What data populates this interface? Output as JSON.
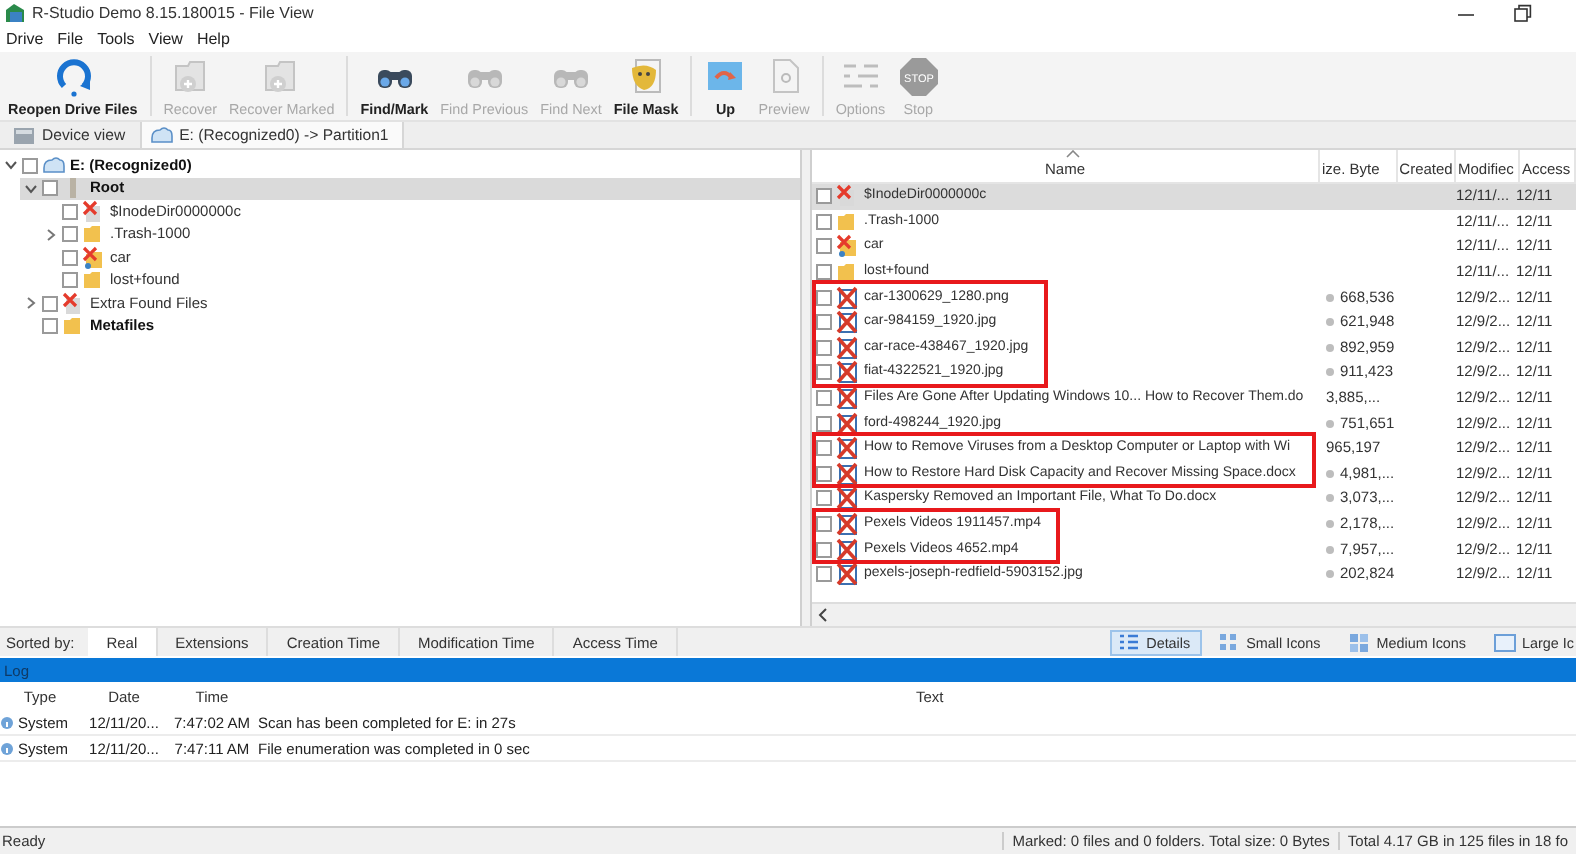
{
  "window": {
    "title": "R-Studio Demo 8.15.180015 - File View"
  },
  "menu": [
    "Drive",
    "File",
    "Tools",
    "View",
    "Help"
  ],
  "toolbar": [
    {
      "buttons": [
        {
          "label": "Reopen Drive Files",
          "kind": "reopen",
          "disabled": false
        }
      ]
    },
    {
      "buttons": [
        {
          "label": "Recover",
          "kind": "recover",
          "disabled": true
        },
        {
          "label": "Recover Marked",
          "kind": "recover",
          "disabled": true
        }
      ]
    },
    {
      "buttons": [
        {
          "label": "Find/Mark",
          "kind": "binoculars",
          "disabled": false
        },
        {
          "label": "Find Previous",
          "kind": "binoculars",
          "disabled": true
        },
        {
          "label": "Find Next",
          "kind": "binoculars",
          "disabled": true
        },
        {
          "label": "File Mask",
          "kind": "mask",
          "disabled": false
        }
      ]
    },
    {
      "buttons": [
        {
          "label": "Up",
          "kind": "up",
          "disabled": false
        },
        {
          "label": "Preview",
          "kind": "preview",
          "disabled": true
        }
      ]
    },
    {
      "buttons": [
        {
          "label": "Options",
          "kind": "options",
          "disabled": true
        },
        {
          "label": "Stop",
          "kind": "stop",
          "disabled": true,
          "icon_text": "STOP"
        }
      ]
    }
  ],
  "tabs": [
    {
      "label": "Device view",
      "kind": "device",
      "selected": false
    },
    {
      "label": "E: (Recognized0) -> Partition1",
      "kind": "drive",
      "selected": true
    }
  ],
  "tree": [
    {
      "label": "E: (Recognized0)",
      "kind": "drive",
      "bold": true,
      "checked": false,
      "selected": false,
      "expanded": true,
      "children": [
        {
          "label": "Root",
          "kind": "root",
          "bold": true,
          "checked": false,
          "selected": true,
          "expanded": true,
          "children": [
            {
              "label": "$InodeDir0000000c",
              "kind": "deleted-entry",
              "bold": false,
              "checked": false,
              "selected": false
            },
            {
              "label": ".Trash-1000",
              "kind": "folder",
              "bold": false,
              "checked": false,
              "selected": false,
              "expanded": false
            },
            {
              "label": "car",
              "kind": "deleted-folder",
              "bold": false,
              "checked": false,
              "selected": false
            },
            {
              "label": "lost+found",
              "kind": "folder",
              "bold": false,
              "checked": false,
              "selected": false
            }
          ]
        },
        {
          "label": "Extra Found Files",
          "kind": "deleted-entry",
          "bold": false,
          "checked": false,
          "selected": false,
          "expanded": false
        },
        {
          "label": "Metafiles",
          "kind": "folder",
          "bold": true,
          "checked": false,
          "selected": false
        }
      ]
    }
  ],
  "file_list": {
    "columns": [
      "Name",
      "ize. Byte",
      "Created",
      "Modifiec",
      "Access"
    ],
    "blocks": [
      {
        "highlighted": false,
        "rows": [
          {
            "name": "$InodeDir0000000c",
            "kind": "deleted-entry",
            "checked": false,
            "selected": true,
            "modified": "12/11/...",
            "accessed": "12/11"
          },
          {
            "name": ".Trash-1000",
            "kind": "folder",
            "checked": false,
            "selected": false,
            "modified": "12/11/...",
            "accessed": "12/11"
          },
          {
            "name": "car",
            "kind": "deleted-folder",
            "checked": false,
            "selected": false,
            "modified": "12/11/...",
            "accessed": "12/11"
          },
          {
            "name": "lost+found",
            "kind": "folder",
            "checked": false,
            "selected": false,
            "modified": "12/11/...",
            "accessed": "12/11"
          }
        ]
      },
      {
        "highlighted": true,
        "rows": [
          {
            "name": "car-1300629_1280.png",
            "kind": "deleted-file",
            "checked": false,
            "selected": false,
            "dot": true,
            "size": "668,536",
            "modified": "12/9/2...",
            "accessed": "12/11"
          },
          {
            "name": "car-984159_1920.jpg",
            "kind": "deleted-file",
            "checked": false,
            "selected": false,
            "dot": true,
            "size": "621,948",
            "modified": "12/9/2...",
            "accessed": "12/11"
          },
          {
            "name": "car-race-438467_1920.jpg",
            "kind": "deleted-file",
            "checked": false,
            "selected": false,
            "dot": true,
            "size": "892,959",
            "modified": "12/9/2...",
            "accessed": "12/11"
          },
          {
            "name": "fiat-4322521_1920.jpg",
            "kind": "deleted-file",
            "checked": false,
            "selected": false,
            "dot": true,
            "size": "911,423",
            "modified": "12/9/2...",
            "accessed": "12/11"
          }
        ]
      },
      {
        "highlighted": false,
        "rows": [
          {
            "name": "Files Are Gone After Updating Windows 10... How to Recover Them.do",
            "kind": "deleted-file",
            "checked": false,
            "selected": false,
            "dot": false,
            "size": "3,885,...",
            "modified": "12/9/2...",
            "accessed": "12/11"
          },
          {
            "name": "ford-498244_1920.jpg",
            "kind": "deleted-file",
            "checked": false,
            "selected": false,
            "dot": true,
            "size": "751,651",
            "modified": "12/9/2...",
            "accessed": "12/11"
          }
        ]
      },
      {
        "highlighted": true,
        "rows": [
          {
            "name": "How to Remove Viruses from a Desktop Computer or Laptop with Wi",
            "kind": "deleted-file",
            "checked": false,
            "selected": false,
            "dot": false,
            "size": "965,197",
            "modified": "12/9/2...",
            "accessed": "12/11"
          },
          {
            "name": "How to Restore Hard Disk Capacity and Recover Missing Space.docx",
            "kind": "deleted-file",
            "checked": false,
            "selected": false,
            "dot": true,
            "size": "4,981,...",
            "modified": "12/9/2...",
            "accessed": "12/11"
          }
        ]
      },
      {
        "highlighted": false,
        "rows": [
          {
            "name": "Kaspersky Removed an Important File, What To Do.docx",
            "kind": "deleted-file",
            "checked": false,
            "selected": false,
            "dot": true,
            "size": "3,073,...",
            "modified": "12/9/2...",
            "accessed": "12/11"
          }
        ]
      },
      {
        "highlighted": true,
        "rows": [
          {
            "name": "Pexels Videos 1911457.mp4",
            "kind": "deleted-file",
            "checked": false,
            "selected": false,
            "dot": true,
            "size": "2,178,...",
            "modified": "12/9/2...",
            "accessed": "12/11"
          },
          {
            "name": "Pexels Videos 4652.mp4",
            "kind": "deleted-file",
            "checked": false,
            "selected": false,
            "dot": true,
            "size": "7,957,...",
            "modified": "12/9/2...",
            "accessed": "12/11"
          }
        ]
      },
      {
        "highlighted": false,
        "rows": [
          {
            "name": "pexels-joseph-redfield-5903152.jpg",
            "kind": "deleted-file",
            "checked": false,
            "selected": false,
            "dot": true,
            "size": "202,824",
            "modified": "12/9/2...",
            "accessed": "12/11"
          }
        ]
      }
    ]
  },
  "sort_bar": {
    "label": "Sorted by:",
    "tabs": [
      {
        "label": "Real",
        "selected": true
      },
      {
        "label": "Extensions",
        "selected": false
      },
      {
        "label": "Creation Time",
        "selected": false
      },
      {
        "label": "Modification Time",
        "selected": false
      },
      {
        "label": "Access Time",
        "selected": false
      }
    ]
  },
  "view_buttons": [
    {
      "label": "Details",
      "kind": "details",
      "selected": true
    },
    {
      "label": "Small Icons",
      "kind": "small",
      "selected": false
    },
    {
      "label": "Medium Icons",
      "kind": "medium",
      "selected": false
    },
    {
      "label": "Large Ic",
      "kind": "large",
      "selected": false
    }
  ],
  "log": {
    "title": "Log",
    "columns": [
      "Type",
      "Date",
      "Time",
      "Text"
    ],
    "rows": [
      {
        "type": "System",
        "date": "12/11/20...",
        "time": "7:47:02 AM",
        "text": "Scan has been completed for E: in 27s"
      },
      {
        "type": "System",
        "date": "12/11/20...",
        "time": "7:47:11 AM",
        "text": "File enumeration was completed in 0 sec"
      }
    ]
  },
  "status_bar": [
    "Ready",
    "Marked: 0 files and 0 folders. Total size: 0 Bytes",
    "Total 4.17 GB in 125 files in 18 fo"
  ]
}
